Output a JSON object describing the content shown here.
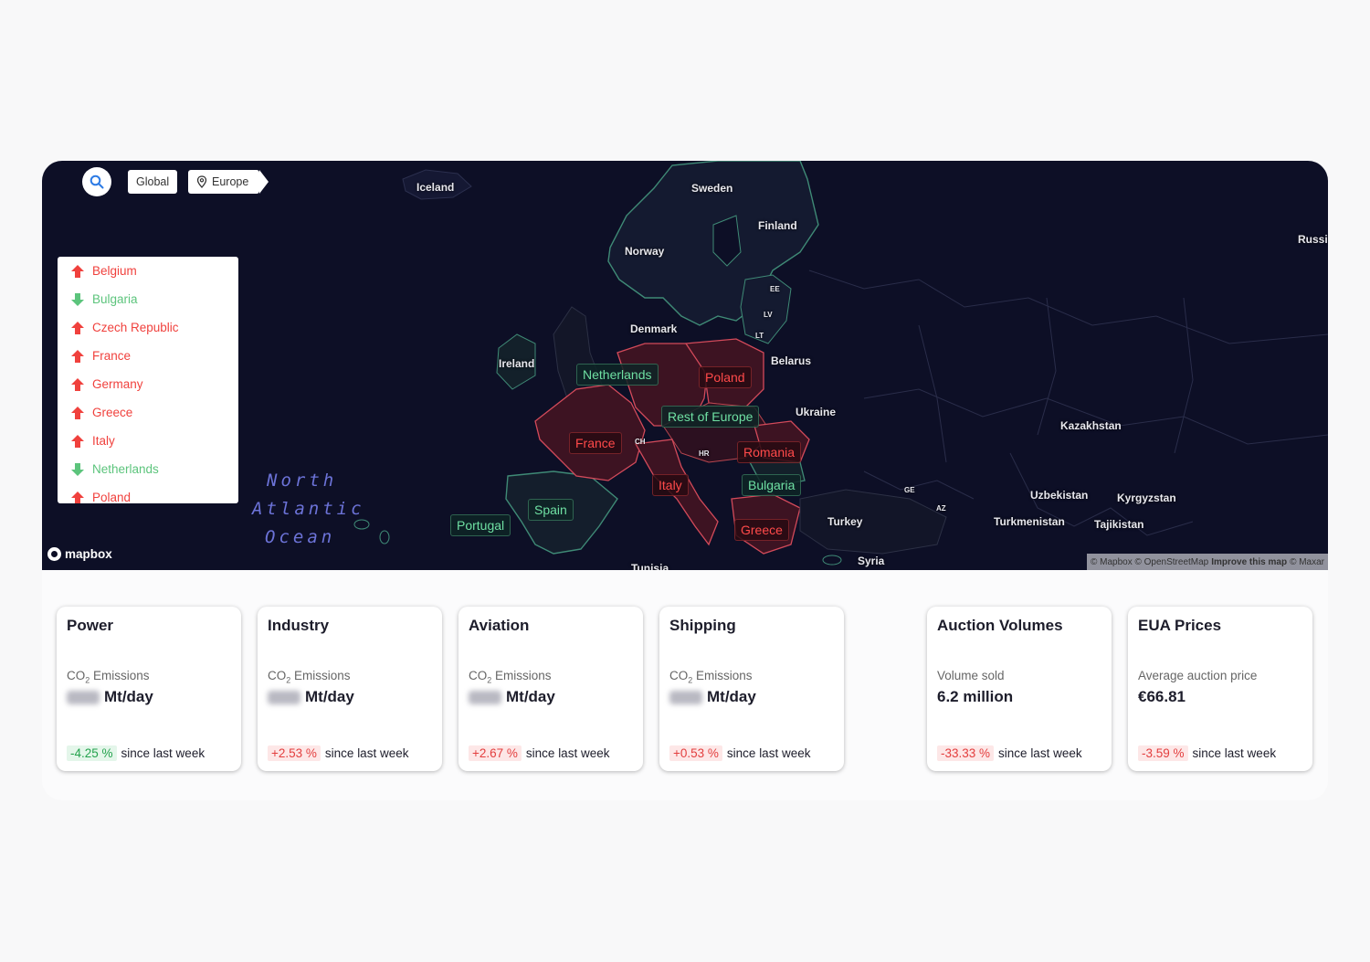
{
  "toolbar": {
    "breadcrumbs": [
      "Global",
      "Europe"
    ]
  },
  "legend": {
    "items": [
      {
        "label": "Belgium",
        "trend": "up"
      },
      {
        "label": "Bulgaria",
        "trend": "down"
      },
      {
        "label": "Czech Republic",
        "trend": "up"
      },
      {
        "label": "France",
        "trend": "up"
      },
      {
        "label": "Germany",
        "trend": "up"
      },
      {
        "label": "Greece",
        "trend": "up"
      },
      {
        "label": "Italy",
        "trend": "up"
      },
      {
        "label": "Netherlands",
        "trend": "down"
      },
      {
        "label": "Poland",
        "trend": "up"
      }
    ]
  },
  "map": {
    "country_labels": [
      "Iceland",
      "Sweden",
      "Finland",
      "Norway",
      "Russia",
      "EE",
      "LV",
      "LT",
      "Denmark",
      "Belarus",
      "Ireland",
      "Ukraine",
      "Kazakhstan",
      "CH",
      "HR",
      "Uzbekistan",
      "Kyrgyzstan",
      "GE",
      "AZ",
      "Turkey",
      "Turkmenistan",
      "Tajikistan",
      "Syria",
      "Tunisia"
    ],
    "tags": [
      {
        "label": "Netherlands",
        "trend": "down"
      },
      {
        "label": "Poland",
        "trend": "up"
      },
      {
        "label": "Rest of Europe",
        "trend": "down"
      },
      {
        "label": "France",
        "trend": "up"
      },
      {
        "label": "Romania",
        "trend": "up"
      },
      {
        "label": "Italy",
        "trend": "up"
      },
      {
        "label": "Bulgaria",
        "trend": "down"
      },
      {
        "label": "Spain",
        "trend": "down"
      },
      {
        "label": "Portugal",
        "trend": "down"
      },
      {
        "label": "Greece",
        "trend": "up"
      }
    ],
    "ocean_lines": [
      "North",
      "Atlantic",
      "Ocean"
    ],
    "logo": "mapbox",
    "attribution": {
      "a": "© Mapbox © OpenStreetMap",
      "b": "Improve this map",
      "c": "© Maxar"
    },
    "colors": {
      "increase": "#f0413d",
      "decrease": "#5cc47c",
      "background": "#0d0f26"
    }
  },
  "cards": [
    {
      "title": "Power",
      "metric": "CO₂ Emissions",
      "value_unit": "Mt/day",
      "value": "",
      "change": "-4.25 %",
      "change_kind": "neg-good",
      "since": "since last week"
    },
    {
      "title": "Industry",
      "metric": "CO₂ Emissions",
      "value_unit": "Mt/day",
      "value": "",
      "change": "+2.53 %",
      "change_kind": "pos-bad",
      "since": "since last week"
    },
    {
      "title": "Aviation",
      "metric": "CO₂ Emissions",
      "value_unit": "Mt/day",
      "value": "",
      "change": "+2.67 %",
      "change_kind": "pos-bad",
      "since": "since last week"
    },
    {
      "title": "Shipping",
      "metric": "CO₂ Emissions",
      "value_unit": "Mt/day",
      "value": "",
      "change": "+0.53 %",
      "change_kind": "pos-bad",
      "since": "since last week"
    },
    {
      "title": "Auction Volumes",
      "metric": "Volume sold",
      "value_unit": "",
      "value": "6.2 million",
      "change": "-33.33 %",
      "change_kind": "pos-bad",
      "since": "since last week"
    },
    {
      "title": "EUA Prices",
      "metric": "Average auction price",
      "value_unit": "",
      "value": "€66.81",
      "change": "-3.59 %",
      "change_kind": "pos-bad",
      "since": "since last week"
    }
  ]
}
